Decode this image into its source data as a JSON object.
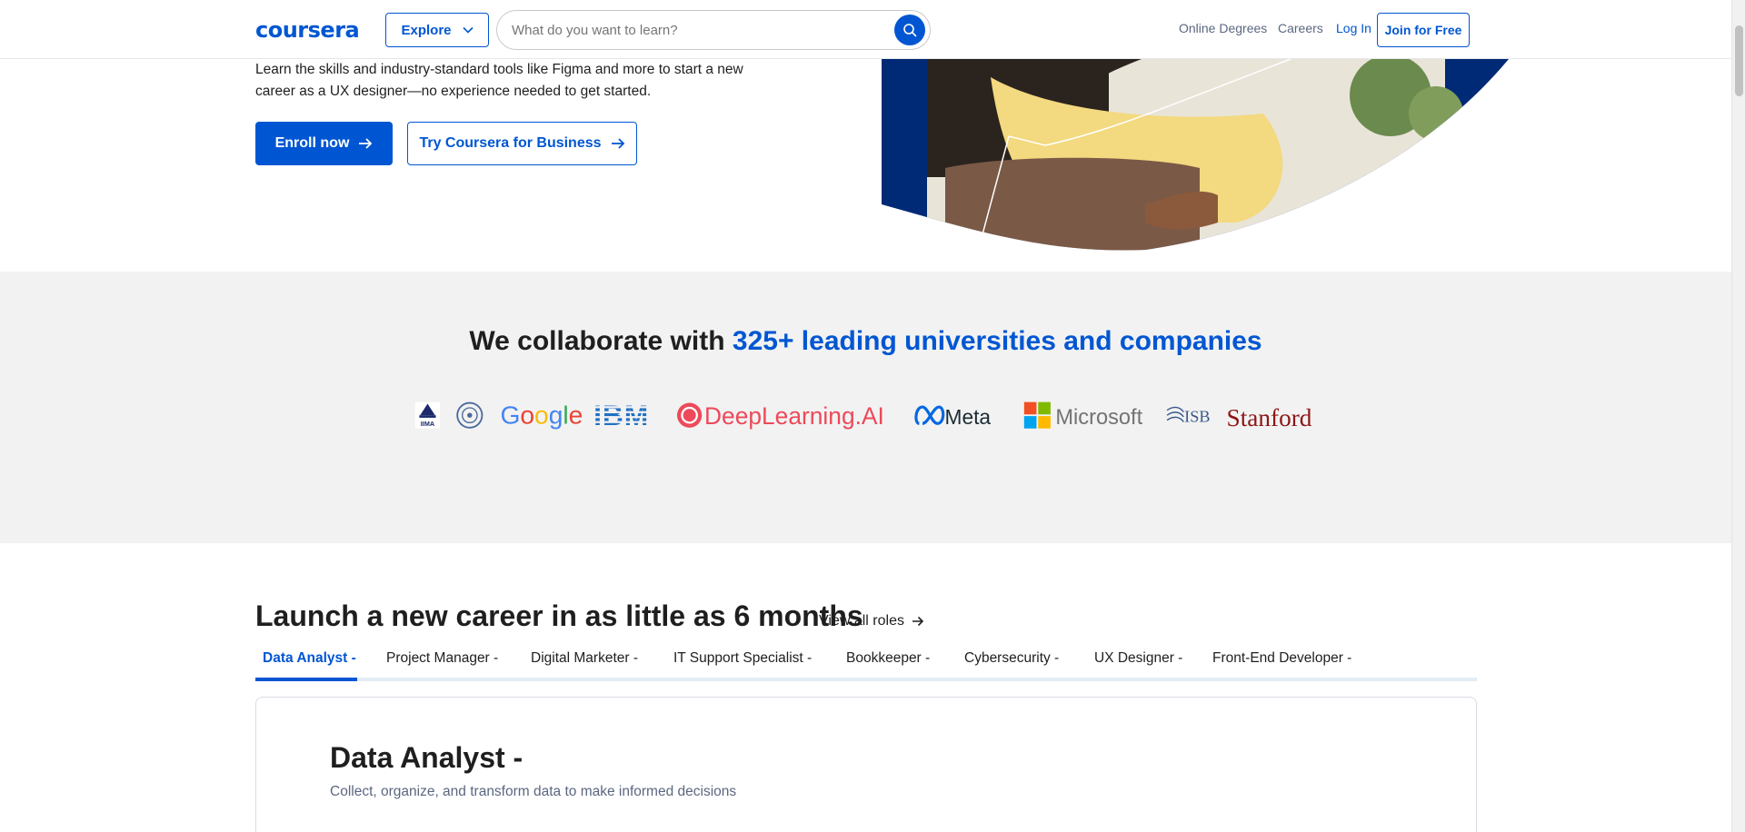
{
  "header": {
    "logo": "coursera",
    "explore_label": "Explore",
    "search_placeholder": "What do you want to learn?",
    "nav": [
      "Online Degrees",
      "Careers",
      "Log In"
    ],
    "join_label": "Join for Free"
  },
  "hero": {
    "description": "Learn the skills and industry-standard tools like Figma and more to start a new career as a UX designer—no experience needed to get started.",
    "enroll_label": "Enroll now",
    "business_label": "Try Coursera for Business"
  },
  "partners": {
    "title_prefix": "We collaborate with",
    "title_highlight": "325+ leading universities and companies",
    "logos": [
      "IIMA",
      "Google",
      "IBM",
      "DeepLearning.AI",
      "Meta",
      "Microsoft",
      "ISB",
      "Stanford"
    ]
  },
  "careers": {
    "title": "Launch a new career in as little as 6 months",
    "view_all": "View all roles",
    "tabs": [
      "Data Analyst -",
      "Project Manager -",
      "Digital Marketer -",
      "IT Support Specialist -",
      "Bookkeeper -",
      "Cybersecurity -",
      "UX Designer -",
      "Front-End Developer -"
    ],
    "active_tab": 0,
    "card": {
      "title": "Data Analyst -",
      "description": "Collect, organize, and transform data to make informed decisions"
    }
  },
  "colors": {
    "brand": "#0056d2",
    "partners_bg": "#f2f2f2"
  }
}
